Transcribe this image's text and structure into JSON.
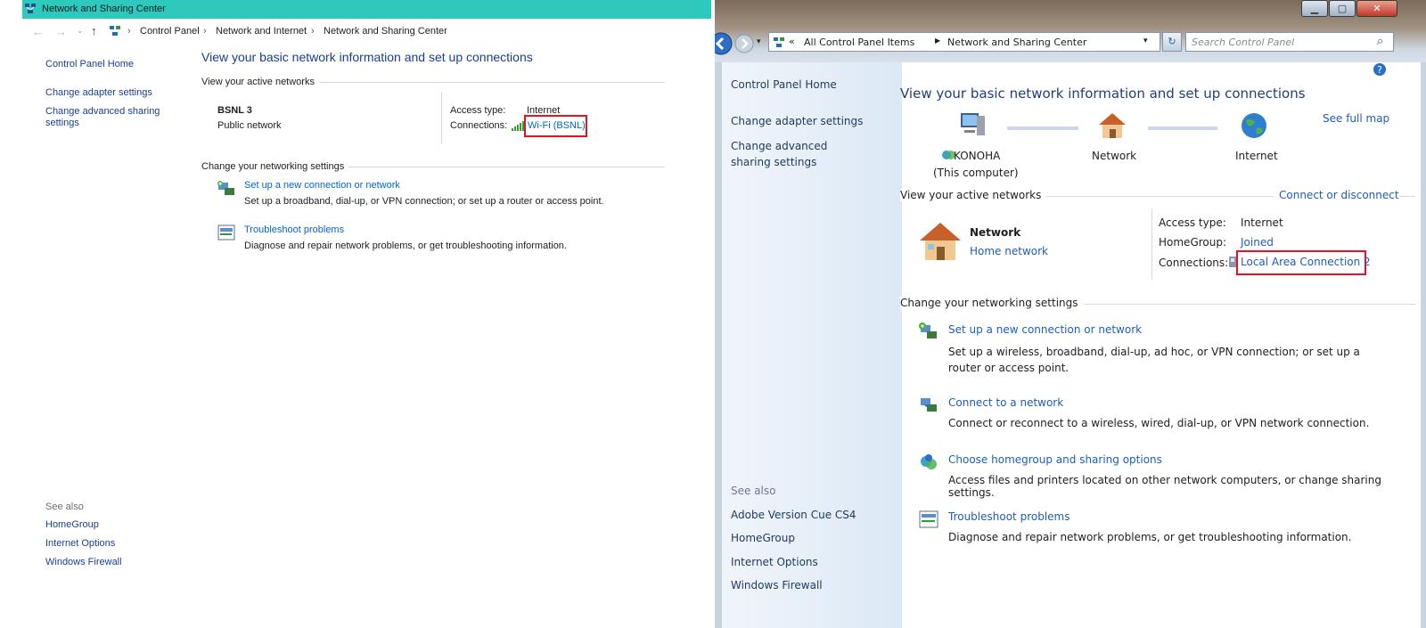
{
  "left": {
    "window_title": "Network and Sharing Center",
    "breadcrumb": [
      "Control Panel",
      "Network and Internet",
      "Network and Sharing Center"
    ],
    "sidebar": {
      "home": "Control Panel Home",
      "items": [
        "Change adapter settings",
        "Change advanced sharing settings"
      ],
      "see_also_label": "See also",
      "see_also": [
        "HomeGroup",
        "Internet Options",
        "Windows Firewall"
      ]
    },
    "main": {
      "heading": "View your basic network information and set up connections",
      "active_networks_label": "View your active networks",
      "network_name": "BSNL 3",
      "network_type": "Public network",
      "access_type_label": "Access type:",
      "access_type_value": "Internet",
      "connections_label": "Connections:",
      "connection_link": "Wi-Fi (BSNL)",
      "change_settings_label": "Change your networking settings",
      "tasks": [
        {
          "title": "Set up a new connection or network",
          "desc": "Set up a broadband, dial-up, or VPN connection; or set up a router or access point."
        },
        {
          "title": "Troubleshoot problems",
          "desc": "Diagnose and repair network problems, or get troubleshooting information."
        }
      ]
    }
  },
  "right": {
    "address": {
      "items": [
        "All Control Panel Items",
        "Network and Sharing Center"
      ],
      "search_placeholder": "Search Control Panel"
    },
    "sidebar": {
      "home": "Control Panel Home",
      "items": [
        "Change adapter settings",
        "Change advanced sharing settings"
      ],
      "see_also_label": "See also",
      "see_also": [
        "Adobe Version Cue CS4",
        "HomeGroup",
        "Internet Options",
        "Windows Firewall"
      ]
    },
    "main": {
      "heading": "View your basic network information and set up connections",
      "see_full_map": "See full map",
      "map": {
        "computer_name": "KONOHA",
        "computer_sub": "(This computer)",
        "network": "Network",
        "internet": "Internet"
      },
      "active_networks_label": "View your active networks",
      "connect_disconnect": "Connect or disconnect",
      "network_name": "Network",
      "network_type": "Home network",
      "access_type_label": "Access type:",
      "access_type_value": "Internet",
      "homegroup_label": "HomeGroup:",
      "homegroup_value": "Joined",
      "connections_label": "Connections:",
      "connection_link": "Local Area Connection 2",
      "change_settings_label": "Change your networking settings",
      "tasks": [
        {
          "title": "Set up a new connection or network",
          "desc": "Set up a wireless, broadband, dial-up, ad hoc, or VPN connection; or set up a router or access point."
        },
        {
          "title": "Connect to a network",
          "desc": "Connect or reconnect to a wireless, wired, dial-up, or VPN network connection."
        },
        {
          "title": "Choose homegroup and sharing options",
          "desc": "Access files and printers located on other network computers, or change sharing settings."
        },
        {
          "title": "Troubleshoot problems",
          "desc": "Diagnose and repair network problems, or get troubleshooting information."
        }
      ]
    }
  },
  "colors": {
    "win10_titlebar": "#2ec9bd",
    "link": "#0066cc",
    "highlight_box": "#e81123"
  }
}
